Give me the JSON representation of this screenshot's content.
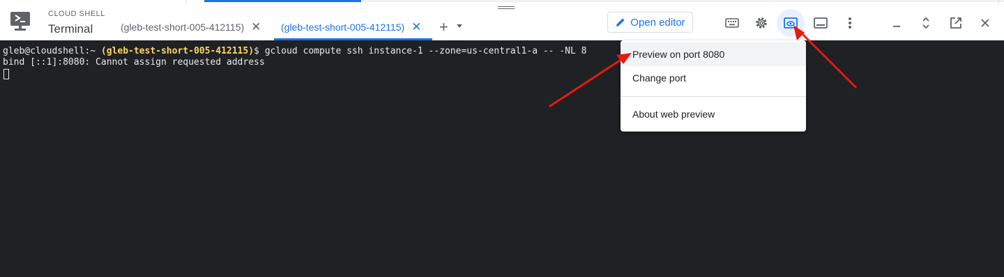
{
  "header": {
    "brand_small": "CLOUD SHELL",
    "brand_title": "Terminal",
    "open_editor_label": "Open editor"
  },
  "tabs": [
    {
      "label": "(gleb-test-short-005-412115)",
      "close": "✕"
    },
    {
      "label": "(gleb-test-short-005-412115)",
      "close": "✕"
    }
  ],
  "add_tab": "+",
  "terminal": {
    "prompt_user": "gleb@cloudshell:~ ",
    "project": "(gleb-test-short-005-412115)",
    "command": "$ gcloud compute ssh instance-1 --zone=us-central1-a -- -NL 8",
    "error": "bind [::1]:8080: Cannot assign requested address"
  },
  "menu": {
    "items": [
      "Preview on port 8080",
      "Change port",
      "About web preview"
    ]
  },
  "colors": {
    "accent": "#1a73e8",
    "terminal_bg": "#202124",
    "project_text": "#fdd663",
    "annotation_arrow": "#e8190e"
  }
}
